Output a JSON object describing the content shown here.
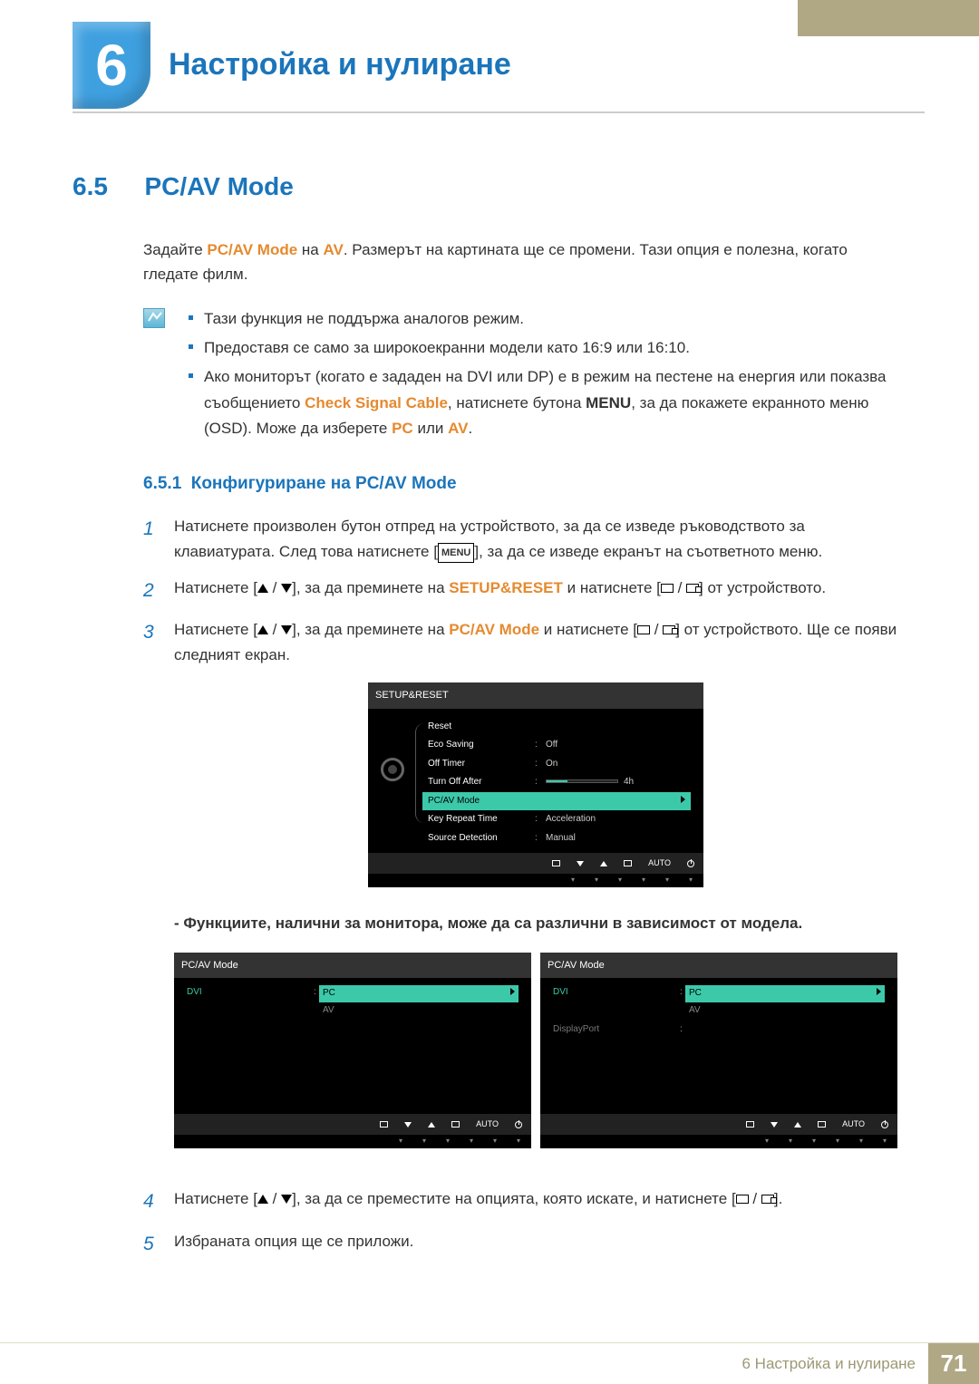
{
  "header": {
    "chapter_number": "6",
    "chapter_title": "Настройка и нулиране"
  },
  "section": {
    "number": "6.5",
    "title": "PC/AV Mode",
    "intro_prefix": "Задайте ",
    "intro_term1": "PC/AV Mode",
    "intro_mid": " на ",
    "intro_term2": "AV",
    "intro_suffix": ". Размерът на картината ще се промени. Тази опция е полезна, когато гледате филм."
  },
  "notes": {
    "n1": "Тази функция не поддържа аналогов режим.",
    "n2": "Предоставя се само за широкоекранни модели като 16:9 или 16:10.",
    "n3_a": "Ако мониторът (когато е зададен на DVI или DP) е в режим на пестене на енергия или показва съобщението ",
    "n3_csc": "Check Signal Cable",
    "n3_b": ", натиснете бутона ",
    "n3_menu": "MENU",
    "n3_c": ", за да покажете екранното меню (OSD). Може да изберете ",
    "n3_pc": "PC",
    "n3_or": " или ",
    "n3_av": "AV",
    "n3_d": "."
  },
  "subsection": {
    "number": "6.5.1",
    "title": "Конфигуриране на PC/AV Mode"
  },
  "steps": {
    "s1_a": "Натиснете произволен бутон отпред на устройството, за да се изведе ръководството за клавиатурата. След това натиснете [",
    "s1_menu": "MENU",
    "s1_b": "], за да се изведе екранът на съответното меню.",
    "s2_a": "Натиснете [",
    "s2_b": "], за да преминете на ",
    "s2_term": "SETUP&RESET",
    "s2_c": " и натиснете [",
    "s2_d": "] от устройството.",
    "s3_a": "Натиснете [",
    "s3_b": "], за да преминете на ",
    "s3_term": "PC/AV Mode",
    "s3_c": " и натиснете [",
    "s3_d": "] от устройството. Ще се появи следният екран.",
    "s4_a": "Натиснете [",
    "s4_b": "], за да се преместите на опцията, която искате, и натиснете [",
    "s4_c": "].",
    "s5": "Избраната опция ще се приложи."
  },
  "osd_main": {
    "title": "SETUP&RESET",
    "rows": {
      "reset": "Reset",
      "eco": "Eco Saving",
      "eco_v": "Off",
      "offtimer": "Off Timer",
      "offtimer_v": "On",
      "turnoff": "Turn Off After",
      "turnoff_v": "4h",
      "pcav": "PC/AV Mode",
      "keyrep": "Key Repeat Time",
      "keyrep_v": "Acceleration",
      "srcdet": "Source Detection",
      "srcdet_v": "Manual"
    },
    "auto": "AUTO"
  },
  "note_bold": "- Функциите, налични за монитора, може да са различни в зависимост от модела.",
  "osd_a": {
    "title": "PC/AV Mode",
    "dvi": "DVI",
    "pc": "PC",
    "av": "AV",
    "auto": "AUTO"
  },
  "osd_b": {
    "title": "PC/AV Mode",
    "dvi": "DVI",
    "dp": "DisplayPort",
    "pc": "PC",
    "av": "AV",
    "auto": "AUTO"
  },
  "footer": {
    "text": "6 Настройка и нулиране",
    "page": "71"
  }
}
